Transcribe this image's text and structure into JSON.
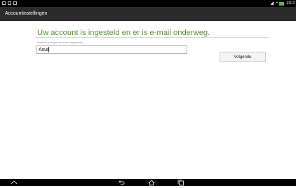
{
  "status_bar": {
    "left_icons": [
      "notification-icon",
      "screenshot-icon",
      "notification-icon"
    ],
    "time": "23:2",
    "colors": {
      "battery": "#54b948"
    }
  },
  "action_bar": {
    "title": "Accountinstellingen"
  },
  "content": {
    "title": "Uw account is ingesteld en er is e-mail onderweg.",
    "account_name_label": "Geef dit account een naam (optioneel)",
    "account_name_value": "Asus",
    "next_button_label": "Volgende"
  },
  "nav_bar": {
    "icons": [
      "up-icon",
      "back-icon",
      "home-icon",
      "recent-apps-icon"
    ]
  },
  "colors": {
    "title_green": "#5c8f31",
    "action_bar_bg": "#2b2b2b"
  }
}
